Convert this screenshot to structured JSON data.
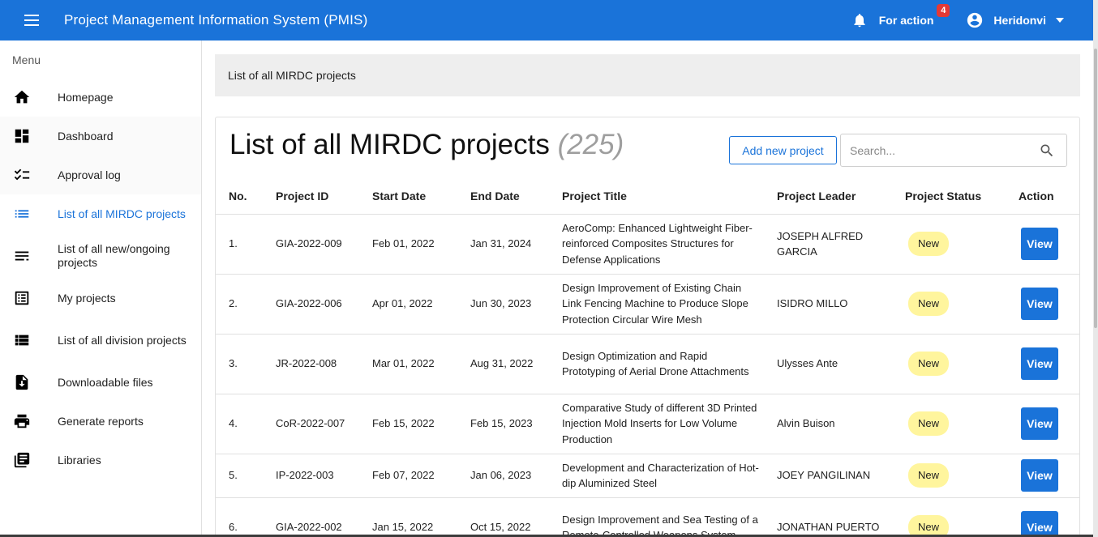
{
  "header": {
    "title": "Project Management Information System (PMIS)",
    "for_action_label": "For action",
    "for_action_count": "4",
    "user_name": "Heridonvi"
  },
  "sidebar": {
    "menu_label": "Menu",
    "items": [
      {
        "label": "Homepage",
        "icon": "home-icon"
      },
      {
        "label": "Dashboard",
        "icon": "dashboard-icon"
      },
      {
        "label": "Approval log",
        "icon": "checklist-icon"
      },
      {
        "label": "List of all MIRDC projects",
        "icon": "list-icon",
        "active": true
      },
      {
        "label": "List of all new/ongoing projects",
        "icon": "notes-icon"
      },
      {
        "label": "My projects",
        "icon": "list-alt-icon"
      },
      {
        "label": "List of all division projects",
        "icon": "view-list-icon"
      },
      {
        "label": "Downloadable files",
        "icon": "download-file-icon"
      },
      {
        "label": "Generate reports",
        "icon": "print-icon"
      },
      {
        "label": "Libraries",
        "icon": "library-books-icon"
      }
    ]
  },
  "breadcrumb": "List of all MIRDC projects",
  "main": {
    "title": "List of all MIRDC projects",
    "count": "(225)",
    "add_button": "Add new project",
    "search_placeholder": "Search...",
    "columns": [
      "No.",
      "Project ID",
      "Start Date",
      "End Date",
      "Project Title",
      "Project Leader",
      "Project Status",
      "Action"
    ],
    "rows": [
      {
        "no": "1.",
        "id": "GIA-2022-009",
        "start": "Feb 01, 2022",
        "end": "Jan 31, 2024",
        "title": "AeroComp: Enhanced Lightweight Fiber-reinforced Composites Structures for Defense Applications",
        "leader": "JOSEPH ALFRED GARCIA",
        "status": "New",
        "action": "View"
      },
      {
        "no": "2.",
        "id": "GIA-2022-006",
        "start": "Apr 01, 2022",
        "end": "Jun 30, 2023",
        "title": "Design Improvement of Existing Chain Link Fencing Machine to Produce Slope Protection Circular Wire Mesh",
        "leader": "ISIDRO MILLO",
        "status": "New",
        "action": "View"
      },
      {
        "no": "3.",
        "id": "JR-2022-008",
        "start": "Mar 01, 2022",
        "end": "Aug 31, 2022",
        "title": "Design Optimization and Rapid Prototyping of Aerial Drone Attachments",
        "leader": "Ulysses Ante",
        "status": "New",
        "action": "View"
      },
      {
        "no": "4.",
        "id": "CoR-2022-007",
        "start": "Feb 15, 2022",
        "end": "Feb 15, 2023",
        "title": "Comparative Study of different 3D Printed Injection Mold Inserts for Low Volume Production",
        "leader": "Alvin Buison",
        "status": "New",
        "action": "View"
      },
      {
        "no": "5.",
        "id": "IP-2022-003",
        "start": "Feb 07, 2022",
        "end": "Jan 06, 2023",
        "title": "Development and Characterization of Hot-dip Aluminized Steel",
        "leader": "JOEY PANGILINAN",
        "status": "New",
        "action": "View"
      },
      {
        "no": "6.",
        "id": "GIA-2022-002",
        "start": "Jan 15, 2022",
        "end": "Oct 15, 2022",
        "title": "Design Improvement and Sea Testing of a Remote-Controlled Weapons System",
        "leader": "JONATHAN PUERTO",
        "status": "New",
        "action": "View"
      }
    ]
  },
  "colors": {
    "primary": "#1a73d9",
    "status_new": "#fff59d",
    "badge": "#e53935"
  }
}
